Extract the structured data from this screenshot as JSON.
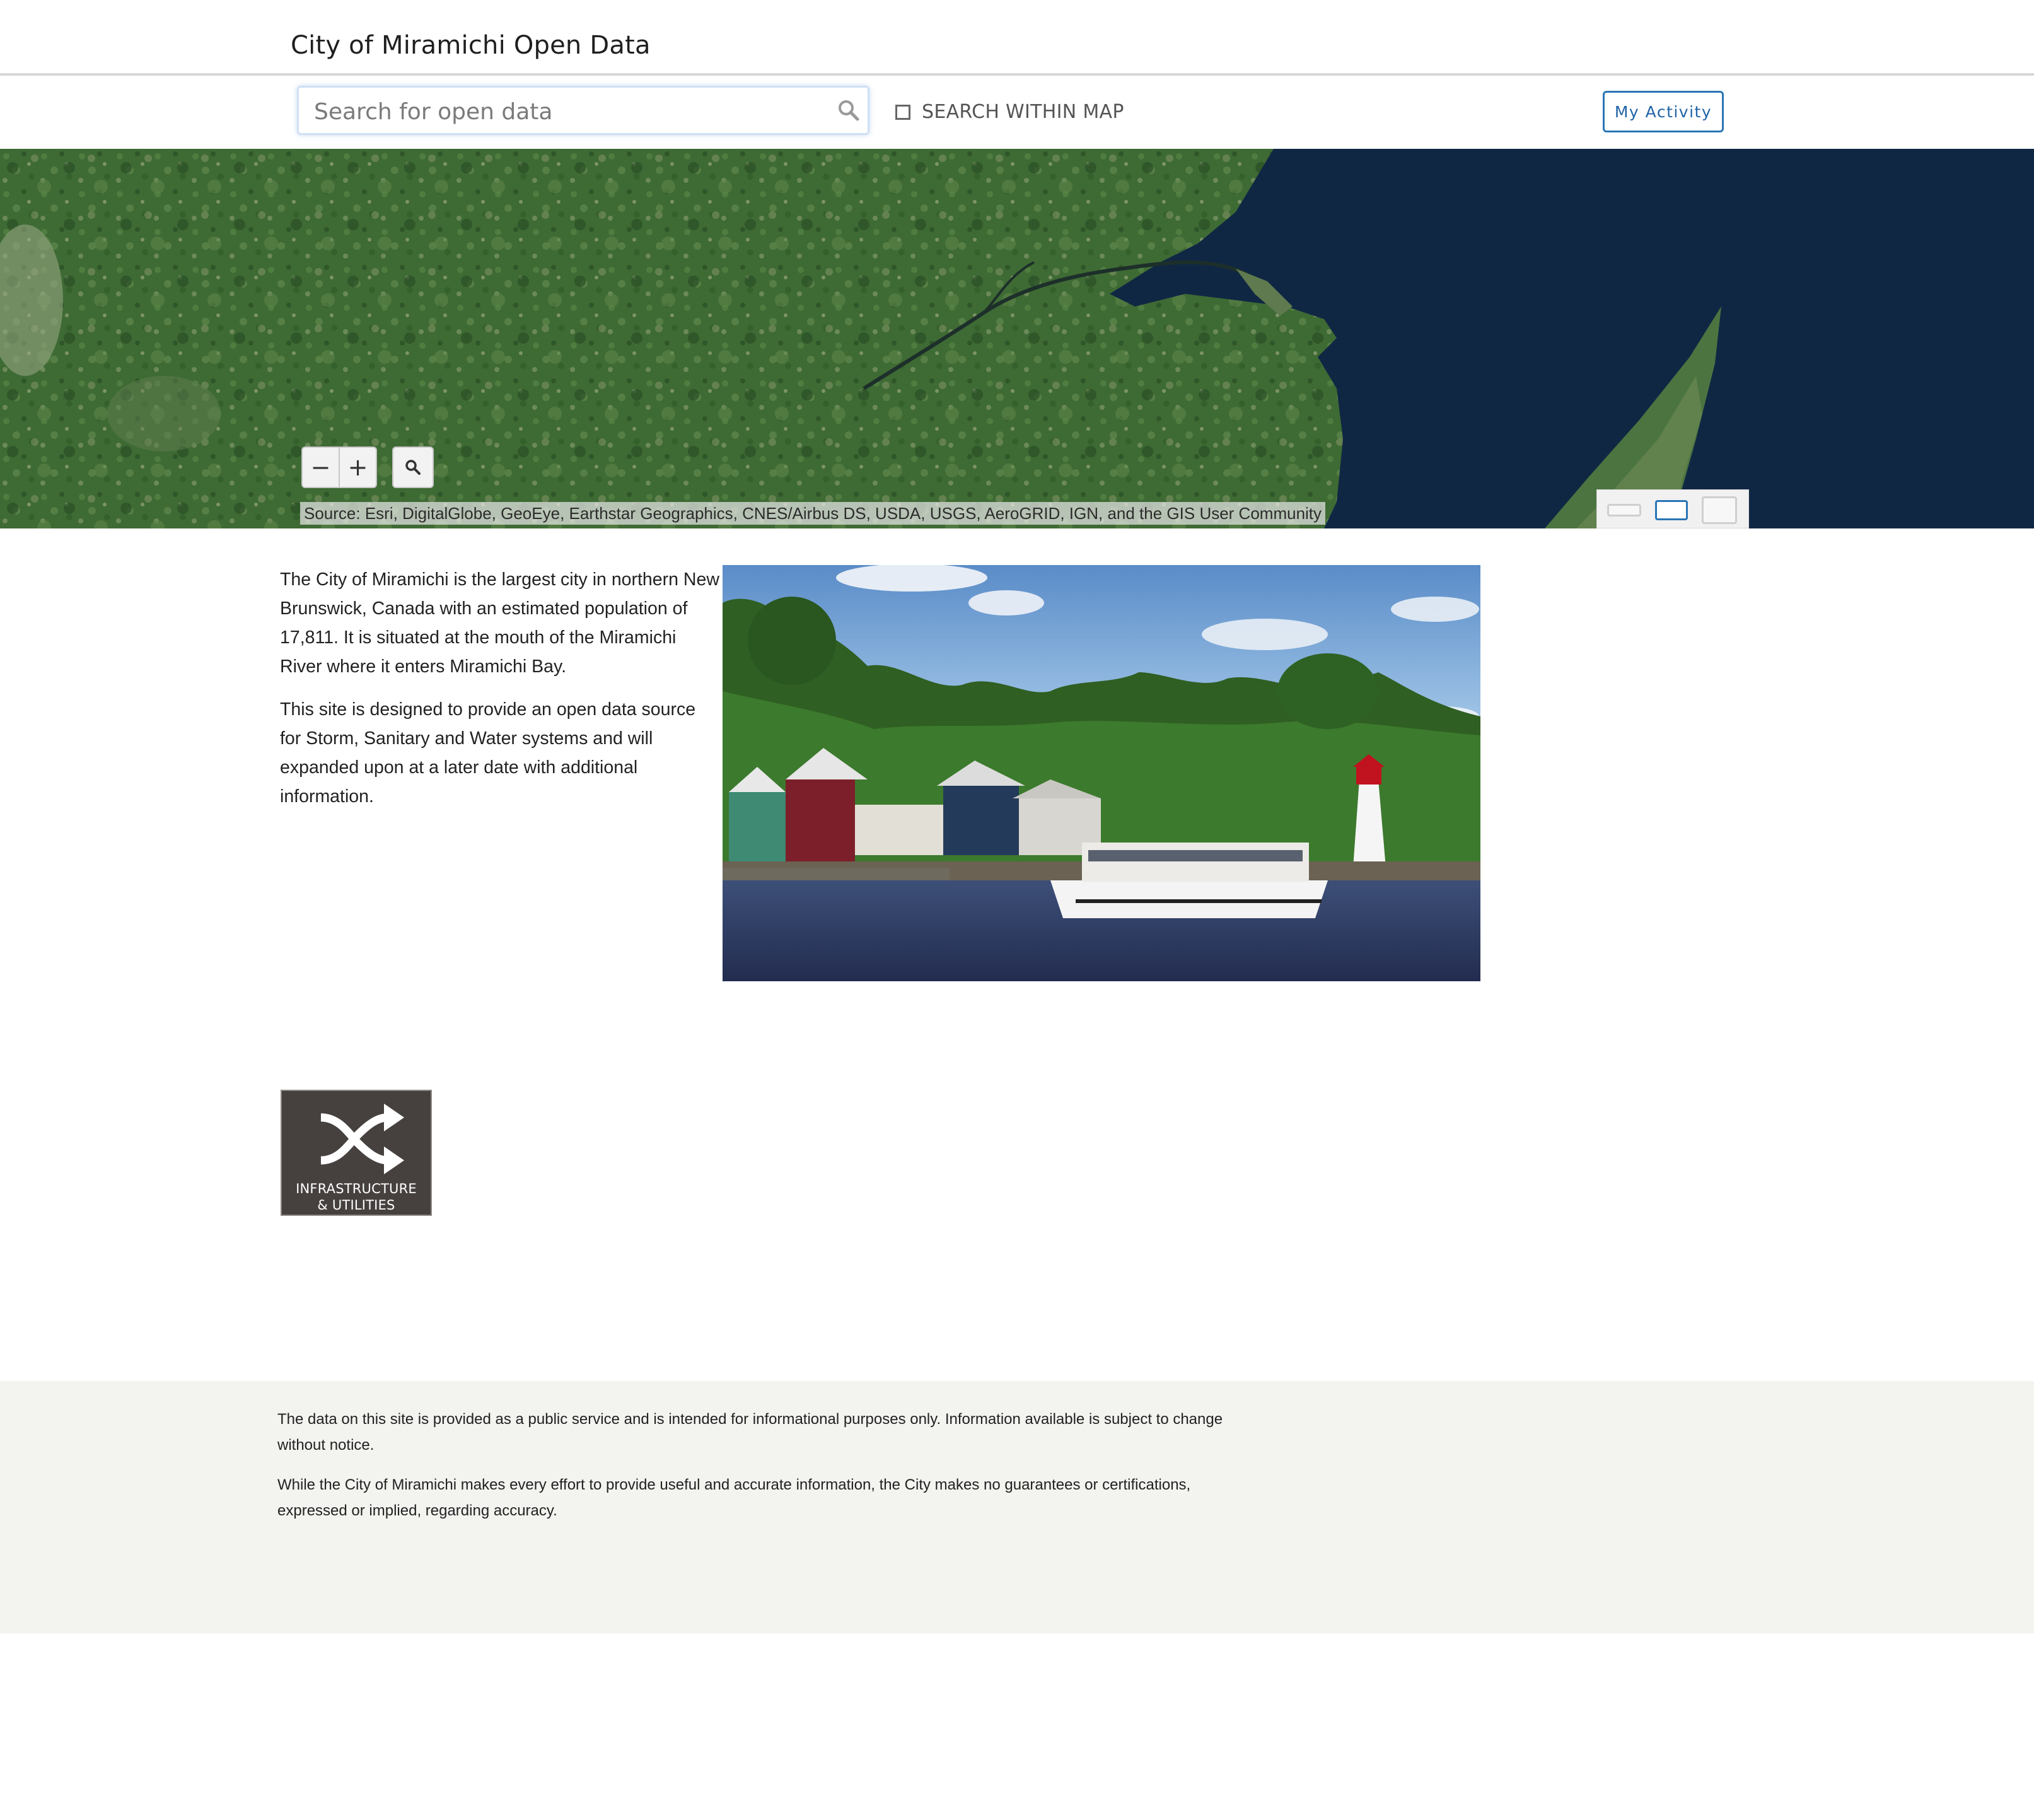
{
  "header": {
    "site_title": "City of Miramichi Open Data"
  },
  "search": {
    "placeholder": "Search for open data",
    "value": "",
    "within_map_label": "SEARCH WITHIN MAP",
    "within_map_checked": false,
    "my_activity_label": "My Activity"
  },
  "map": {
    "zoom_out_label": "−",
    "zoom_in_label": "+",
    "attribution": "Source: Esri, DigitalGlobe, GeoEye, Earthstar Geographics, CNES/Airbus DS, USDA, USGS, AeroGRID, IGN, and the GIS User Community",
    "icons": [
      "search-icon",
      "magnify-icon",
      "basemap-toggle"
    ],
    "colors": {
      "water": "#102744",
      "land": "#3f6a35"
    }
  },
  "content": {
    "paragraph_1": "The City of Miramichi is the largest city in northern New Brunswick, Canada with an estimated population of 17,811. It is situated at the mouth of the Miramichi River where it enters Miramichi Bay.",
    "paragraph_2": "This site is designed to provide an open data source for Storm, Sanitary and Water systems and will expanded upon at a later date with additional information."
  },
  "categories": [
    {
      "label_line_1": "INFRASTRUCTURE",
      "label_line_2": "& UTILITIES",
      "icon": "shuffle-icon"
    }
  ],
  "footer": {
    "disclaimer_1": "The data on this site is provided as a public service and is intended for informational purposes only. Information available is subject to change without notice.",
    "disclaimer_2": "While the City of Miramichi makes every effort to provide useful and accurate information, the City makes no guarantees or certifications, expressed or implied, regarding accuracy."
  },
  "theme": {
    "accent": "#2a75b5",
    "tile_bg": "#46413f",
    "footer_bg": "#f3f3f0"
  }
}
